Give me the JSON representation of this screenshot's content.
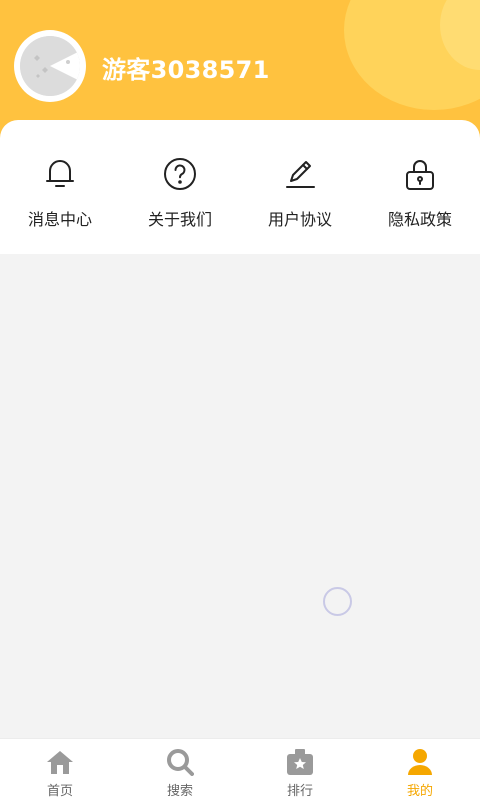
{
  "header": {
    "username": "游客3038571"
  },
  "menu": [
    {
      "label": "消息中心",
      "icon": "bell-icon"
    },
    {
      "label": "关于我们",
      "icon": "question-icon"
    },
    {
      "label": "用户协议",
      "icon": "pencil-icon"
    },
    {
      "label": "隐私政策",
      "icon": "lock-icon"
    }
  ],
  "tabbar": [
    {
      "label": "首页",
      "icon": "home-icon",
      "active": false
    },
    {
      "label": "搜索",
      "icon": "search-icon",
      "active": false
    },
    {
      "label": "排行",
      "icon": "ranking-icon",
      "active": false
    },
    {
      "label": "我的",
      "icon": "user-icon",
      "active": true
    }
  ],
  "colors": {
    "header_bg": "#ffc23f",
    "accent": "#f5a700",
    "tab_inactive": "#9a9a9a",
    "page_bg": "#f3f3f3"
  }
}
